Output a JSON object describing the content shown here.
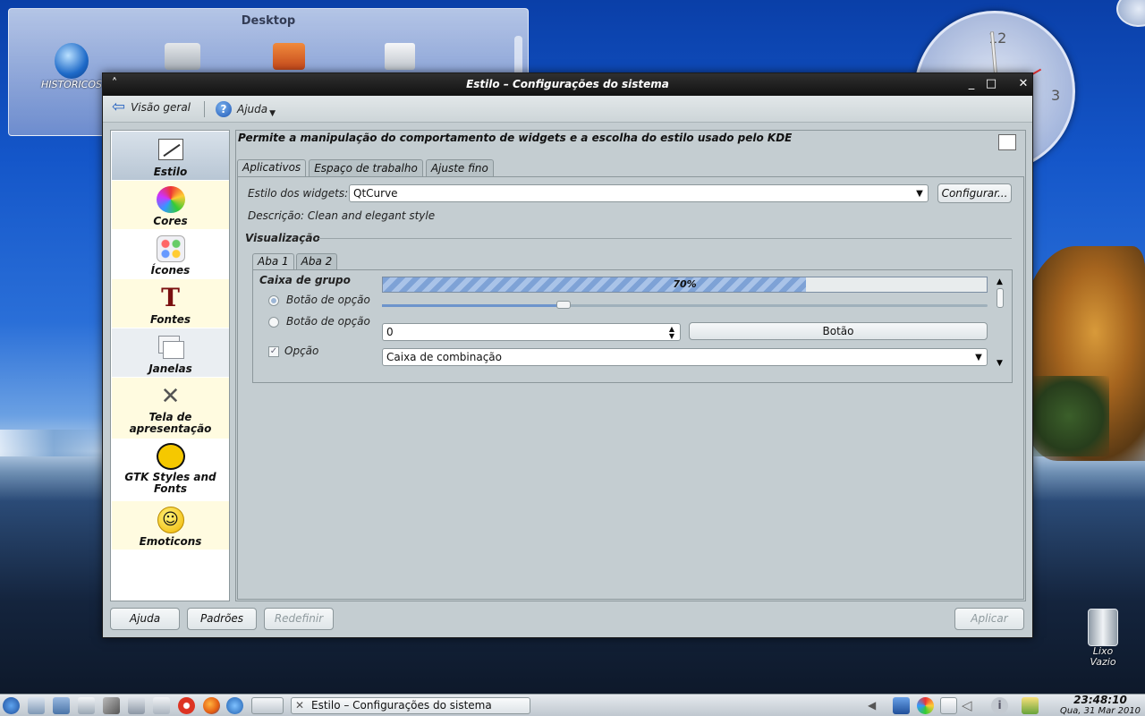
{
  "desktop": {
    "panel_title": "Desktop",
    "icons": [
      {
        "label": "HISTORICOS"
      },
      {
        "label": ""
      },
      {
        "label": ""
      },
      {
        "label": ""
      }
    ]
  },
  "clock_widget": {
    "numerals": [
      "12",
      "3"
    ]
  },
  "window": {
    "title": "Estilo – Configurações do sistema",
    "toolbar": {
      "overview_label": "Visão geral",
      "help_label": "Ajuda"
    },
    "sidebar": {
      "items": [
        {
          "label": "Estilo",
          "icon": "style-icon",
          "selected": true
        },
        {
          "label": "Cores",
          "icon": "colors-icon"
        },
        {
          "label": "Ícones",
          "icon": "icons-icon"
        },
        {
          "label": "Fontes",
          "icon": "fonts-icon"
        },
        {
          "label": "Janelas",
          "icon": "windows-icon"
        },
        {
          "label": "Tela de apresentação",
          "icon": "splash-screen-icon"
        },
        {
          "label": "GTK Styles and Fonts",
          "icon": "gtk-icon"
        },
        {
          "label": "Emoticons",
          "icon": "emoticons-icon"
        }
      ]
    },
    "description": "Permite a manipulação do comportamento de widgets e a escolha do estilo usado pelo KDE",
    "tabs": [
      "Aplicativos",
      "Espaço de trabalho",
      "Ajuste fino"
    ],
    "widget_style": {
      "label": "Estilo dos widgets:",
      "value": "QtCurve",
      "configure_button": "Configurar...",
      "description": "Descrição: Clean and elegant style"
    },
    "preview": {
      "section_title": "Visualização",
      "tabs": [
        "Aba 1",
        "Aba 2"
      ],
      "group_title": "Caixa de grupo",
      "radio1": "Botão de opção",
      "radio2": "Botão de opção",
      "checkbox": "Opção",
      "progress_value": 0.7,
      "progress_text": "70%",
      "slider_value": 0.3,
      "spin_value": "0",
      "button_label": "Botão",
      "combo_value": "Caixa de combinação"
    },
    "buttons": {
      "help": "Ajuda",
      "defaults": "Padrões",
      "reset": "Redefinir",
      "apply": "Aplicar"
    }
  },
  "trash": {
    "label": "Lixo\nVazio"
  },
  "taskbar": {
    "task_label": "Estilo – Configurações do sistema",
    "time": "23:48:10",
    "date": "Qua, 31 Mar 2010"
  }
}
